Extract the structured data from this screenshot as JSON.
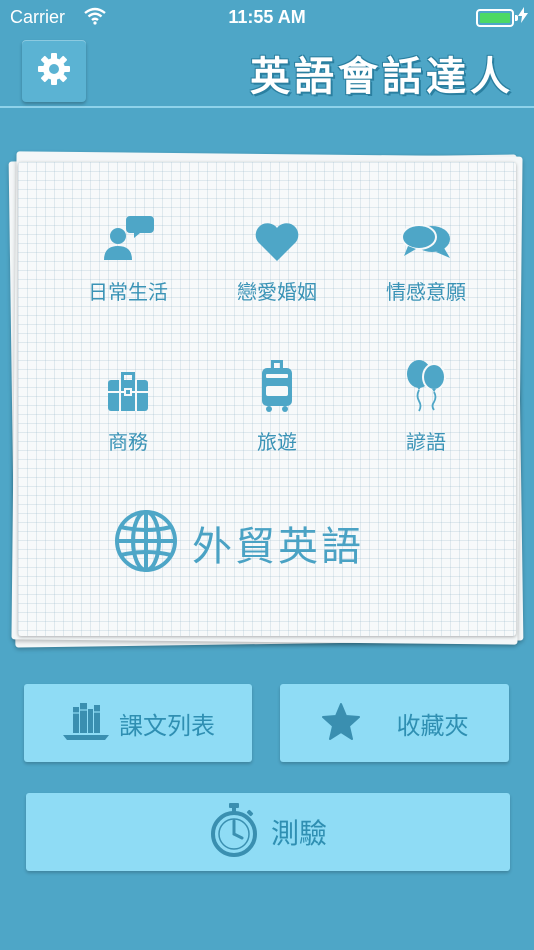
{
  "status_bar": {
    "carrier": "Carrier",
    "time": "11:55 AM",
    "battery_level": 1.0
  },
  "nav": {
    "title": "英語會話達人",
    "settings_icon": "gear-icon"
  },
  "categories": [
    {
      "label": "日常生活",
      "icon": "person-speech-icon"
    },
    {
      "label": "戀愛婚姻",
      "icon": "heart-icon"
    },
    {
      "label": "情感意願",
      "icon": "chat-bubbles-icon"
    },
    {
      "label": "商務",
      "icon": "briefcase-icon"
    },
    {
      "label": "旅遊",
      "icon": "suitcase-icon"
    },
    {
      "label": "諺語",
      "icon": "balloons-icon"
    }
  ],
  "featured": {
    "label": "外貿英語",
    "icon": "globe-icon"
  },
  "buttons": {
    "lesson_list": "課文列表",
    "favorites": "收藏夾",
    "quiz": "測驗"
  },
  "colors": {
    "background": "#4ea6c7",
    "button": "#8fdcf5",
    "accent": "#3a93b6",
    "battery": "#4cd964"
  }
}
